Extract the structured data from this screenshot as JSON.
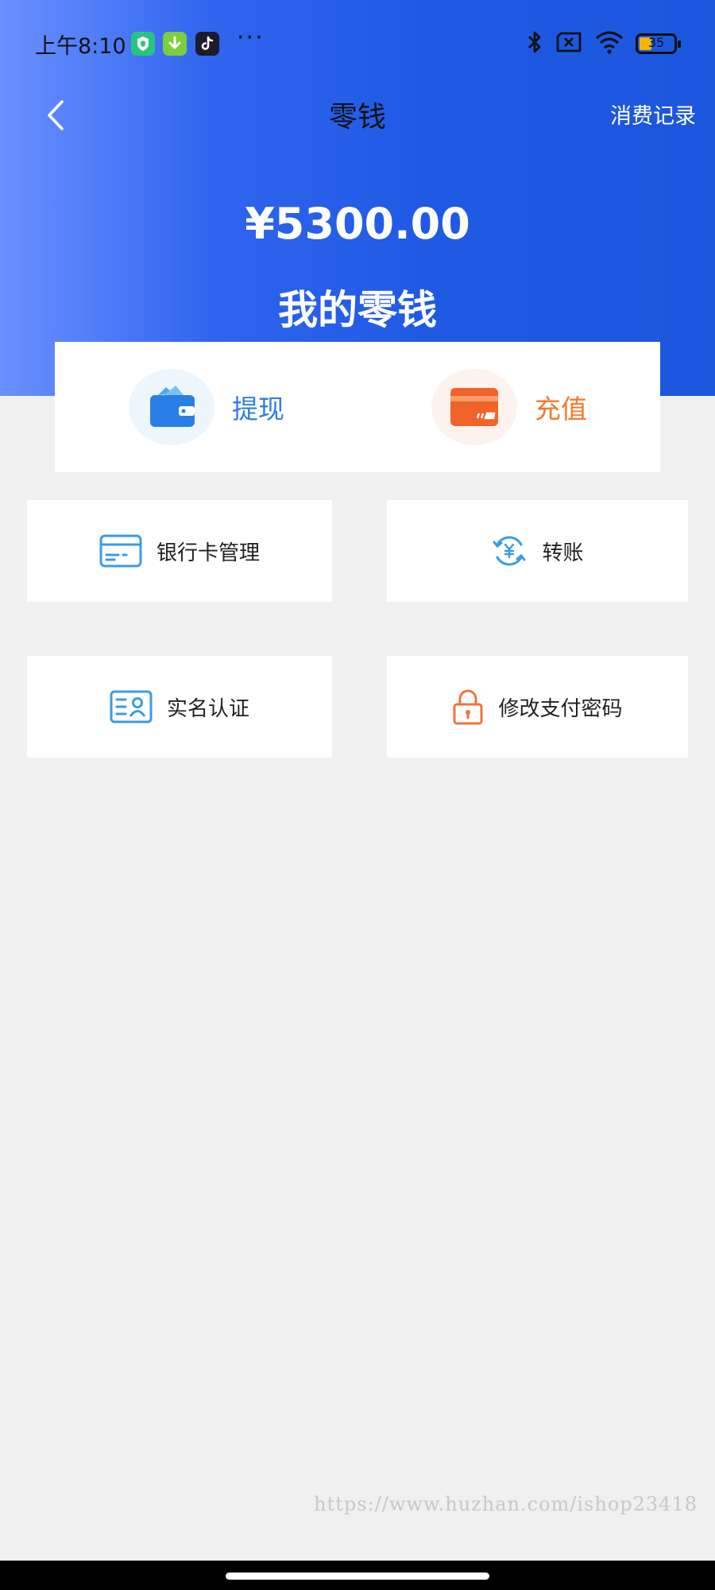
{
  "status_bar": {
    "time": "上午8:10",
    "more": "···",
    "battery": "35",
    "icons": [
      "shield-app-icon",
      "download-app-icon",
      "tiktok-app-icon",
      "bluetooth-icon",
      "no-sim-icon",
      "wifi-icon",
      "battery-icon"
    ],
    "battery_level": 0.35
  },
  "nav": {
    "back_icon": "chevron-left-icon",
    "title": "零钱",
    "right_link": "消费记录"
  },
  "wallet": {
    "amount": "¥5300.00",
    "label": "我的零钱"
  },
  "actions": [
    {
      "label": "提现",
      "icon": "wallet-icon",
      "color": "#2f7de0",
      "bg": "#eef6fd"
    },
    {
      "label": "充值",
      "icon": "credit-card-icon",
      "color": "#f07a2a",
      "bg": "#fdf2ed"
    }
  ],
  "grid": [
    {
      "label": "银行卡管理",
      "icon": "bank-card-icon"
    },
    {
      "label": "转账",
      "icon": "transfer-icon"
    },
    {
      "label": "实名认证",
      "icon": "id-card-icon"
    },
    {
      "label": "修改支付密码",
      "icon": "lock-icon"
    }
  ],
  "watermark": "https://www.huzhan.com/ishop23418"
}
